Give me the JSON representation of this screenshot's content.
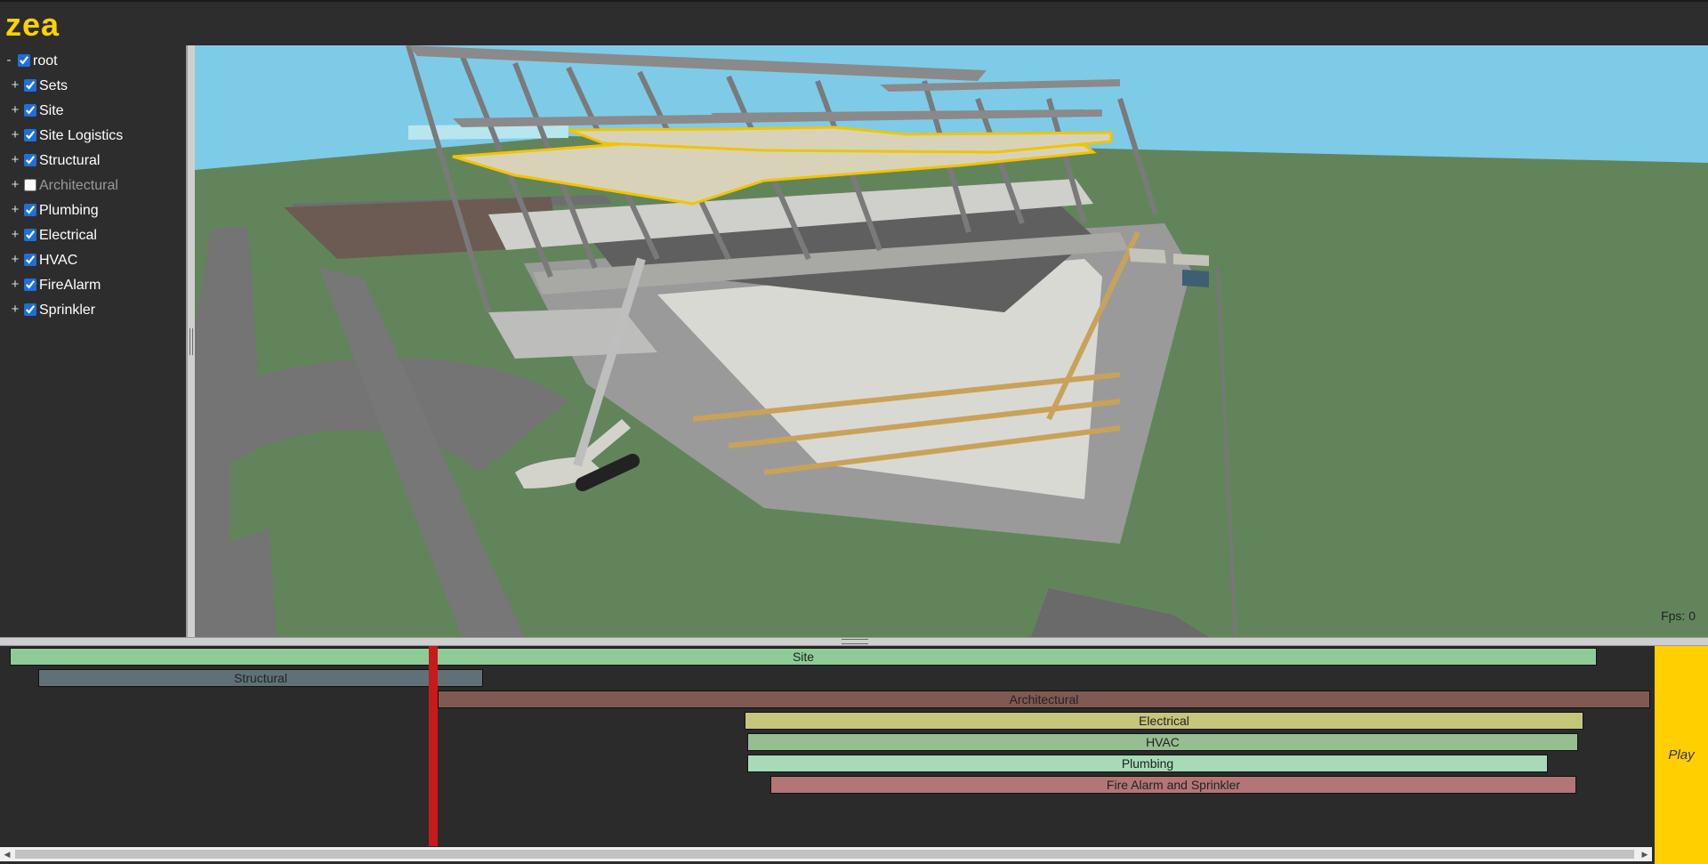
{
  "app": {
    "logo_text": "zea",
    "brand_color": "#ffd200"
  },
  "tree": {
    "items": [
      {
        "toggle": "-",
        "label": "root",
        "checked": true
      },
      {
        "toggle": "+",
        "label": "Sets",
        "checked": true
      },
      {
        "toggle": "+",
        "label": "Site",
        "checked": true
      },
      {
        "toggle": "+",
        "label": "Site Logistics",
        "checked": true
      },
      {
        "toggle": "+",
        "label": "Structural",
        "checked": true
      },
      {
        "toggle": "+",
        "label": "Architectural",
        "checked": false
      },
      {
        "toggle": "+",
        "label": "Plumbing",
        "checked": true
      },
      {
        "toggle": "+",
        "label": "Electrical",
        "checked": true
      },
      {
        "toggle": "+",
        "label": "HVAC",
        "checked": true
      },
      {
        "toggle": "+",
        "label": "FireAlarm",
        "checked": true
      },
      {
        "toggle": "+",
        "label": "Sprinkler",
        "checked": true
      }
    ]
  },
  "viewport": {
    "fps_text": "Fps: 0"
  },
  "timeline": {
    "bars": [
      {
        "label": "Site",
        "color": "#8fcb97"
      },
      {
        "label": "Structural",
        "color": "#5f7176"
      },
      {
        "label": "Architectural",
        "color": "#7f5a52"
      },
      {
        "label": "Electrical",
        "color": "#c4c67a"
      },
      {
        "label": "HVAC",
        "color": "#97bd92"
      },
      {
        "label": "Plumbing",
        "color": "#a7dbb7"
      },
      {
        "label": "Fire Alarm and Sprinkler",
        "color": "#b37578"
      }
    ],
    "playhead_color": "#c8191b"
  },
  "play": {
    "label": "Play",
    "color": "#ffcf00"
  }
}
